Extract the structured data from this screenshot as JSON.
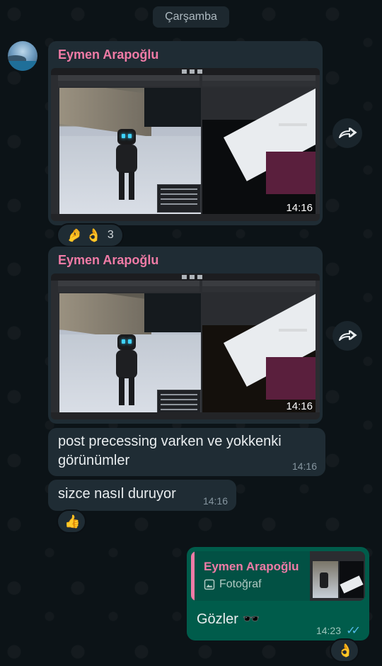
{
  "chat": {
    "date_divider": "Çarşamba",
    "messages": [
      {
        "sender": "Eymen Arapoğlu",
        "type": "image",
        "time": "14:16",
        "reactions": {
          "emojis": "🤌 👌",
          "count": "3"
        }
      },
      {
        "sender": "Eymen Arapoğlu",
        "type": "image",
        "time": "14:16"
      },
      {
        "type": "text",
        "text_line1": "post precessing varken ve yokkenki",
        "text_line2": "görünümler",
        "time": "14:16"
      },
      {
        "type": "text",
        "text": "sizce nasıl duruyor",
        "time": "14:16",
        "reaction": "👍"
      },
      {
        "type": "outgoing",
        "quote": {
          "name": "Eymen Arapoğlu",
          "kind": "Fotoğraf"
        },
        "text": "Gözler 🕶️",
        "time": "14:23",
        "status": "read",
        "reaction": "👌"
      }
    ]
  },
  "colors": {
    "incoming_bubble": "#1f2c34",
    "outgoing_bubble": "#005c4b",
    "sender_name": "#f07ba6",
    "read_ticks": "#53bdeb"
  },
  "icons": {
    "forward": "forward-icon",
    "photo": "photo-icon",
    "read_status": "double-check-icon"
  }
}
